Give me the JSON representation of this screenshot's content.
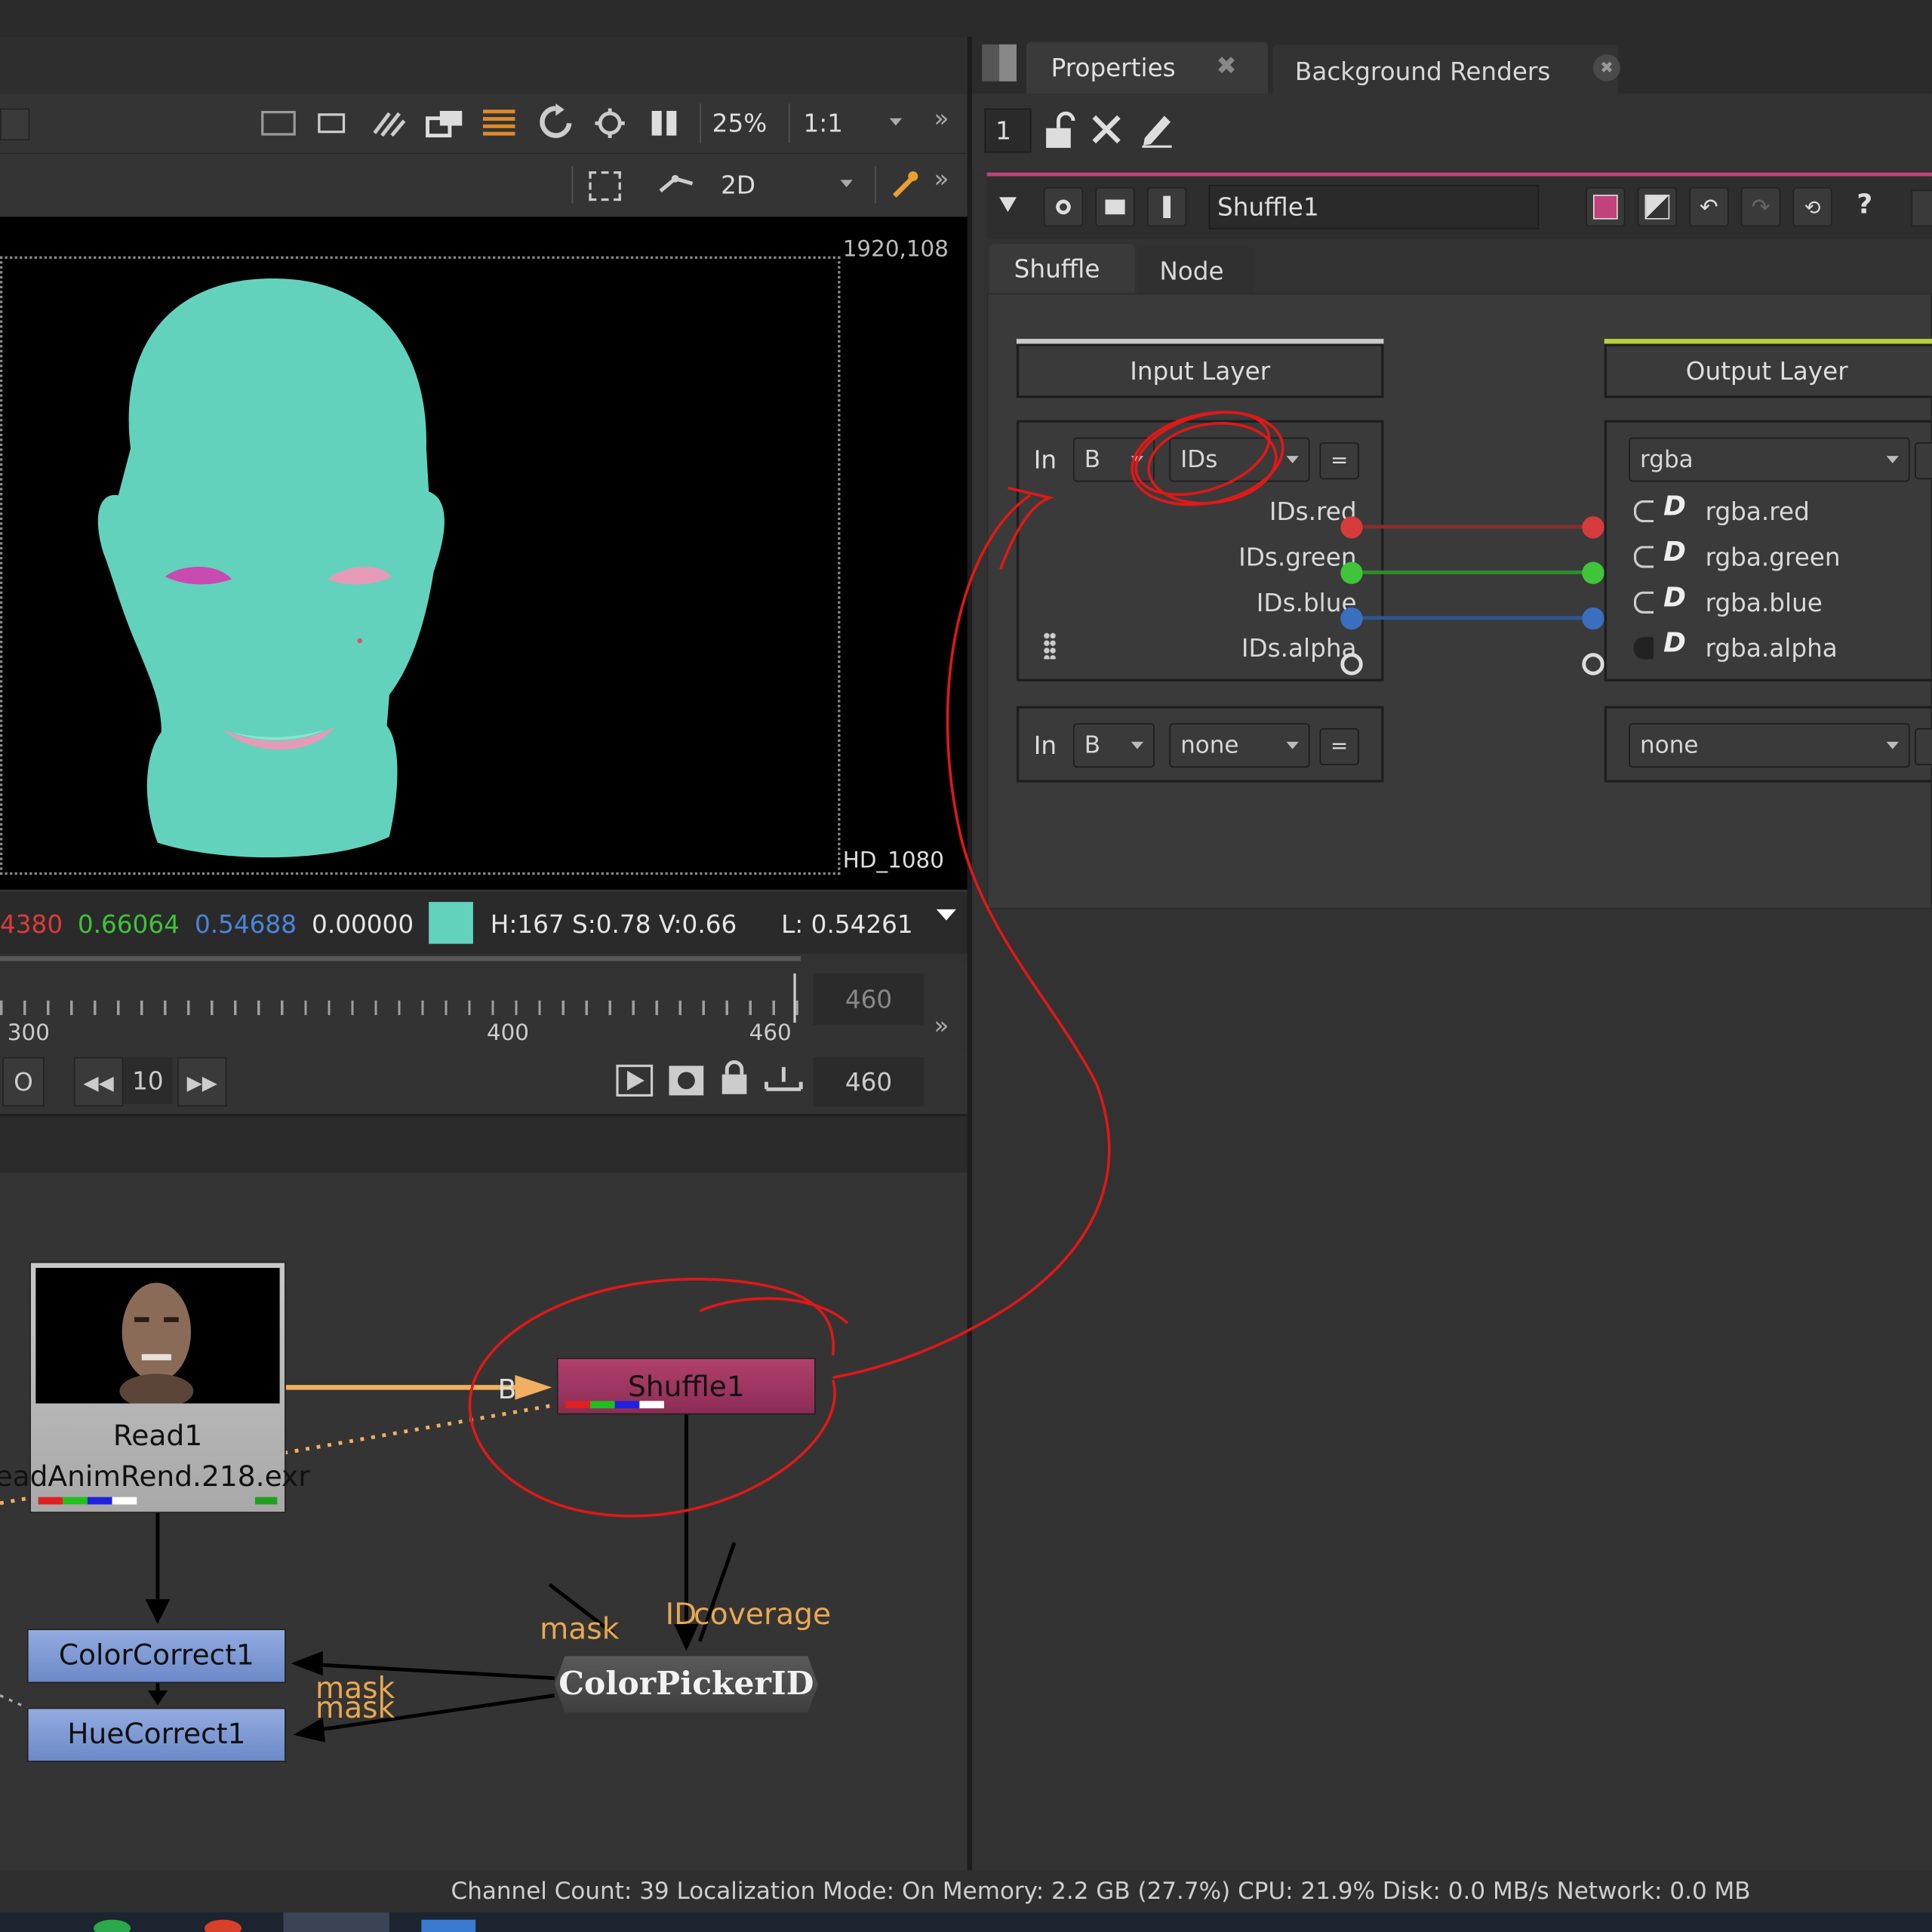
{
  "viewer": {
    "zoom": "25%",
    "ratio": "1:1",
    "view_mode": "2D",
    "format_size": "1920,108",
    "format_name": "HD_1080",
    "pixel": {
      "r": "4380",
      "g": "0.66064",
      "b": "0.54688",
      "a": "0.00000",
      "swatch": "#62d2bd",
      "hsv": "H:167 S:0.78 V:0.66",
      "lum": "L: 0.54261"
    }
  },
  "timeline": {
    "ticks": [
      "300",
      "400",
      "460"
    ],
    "end_frame_top": "460",
    "step": "10",
    "end_frame_bottom": "460",
    "left_btn": "O"
  },
  "nodes": {
    "read": {
      "name": "Read1",
      "file": "eadAnimRend.218.exr"
    },
    "shuffle": {
      "name": "Shuffle1",
      "input_label": "B"
    },
    "colorcorrect": {
      "name": "ColorCorrect1"
    },
    "huecorrect": {
      "name": "HueCorrect1"
    },
    "picker": {
      "name": "ColorPickerID"
    },
    "labels": {
      "mask_top": "mask",
      "id": "ID",
      "coverage": "coverage",
      "mask_a": "mask",
      "mask_b": "mask"
    }
  },
  "properties": {
    "tabs": [
      {
        "label": "Properties"
      },
      {
        "label": "Background Renders"
      }
    ],
    "count": "1",
    "node_name": "Shuffle1",
    "help": "?",
    "subtabs": [
      {
        "label": "Shuffle"
      },
      {
        "label": "Node"
      }
    ],
    "input_layer_title": "Input Layer",
    "output_layer_title": "Output Layer",
    "in_label": "In",
    "in_label2": "In",
    "input_a": {
      "source": "B",
      "layer": "IDs"
    },
    "input_b": {
      "source": "B",
      "layer": "none"
    },
    "output_a": {
      "layer": "rgba"
    },
    "output_b": {
      "layer": "none"
    },
    "eq": "=",
    "channels_in": [
      "IDs.red",
      "IDs.green",
      "IDs.blue",
      "IDs.alpha"
    ],
    "channels_out": [
      "rgba.red",
      "rgba.green",
      "rgba.blue",
      "rgba.alpha"
    ],
    "channel_colors": {
      "red": "#d63b3b",
      "green": "#3fc43a",
      "blue": "#3a6fc0"
    }
  },
  "status_bar": "Channel Count: 39  Localization Mode: On  Memory: 2.2 GB (27.7%)  CPU: 21.9%  Disk: 0.0 MB/s  Network: 0.0 MB"
}
